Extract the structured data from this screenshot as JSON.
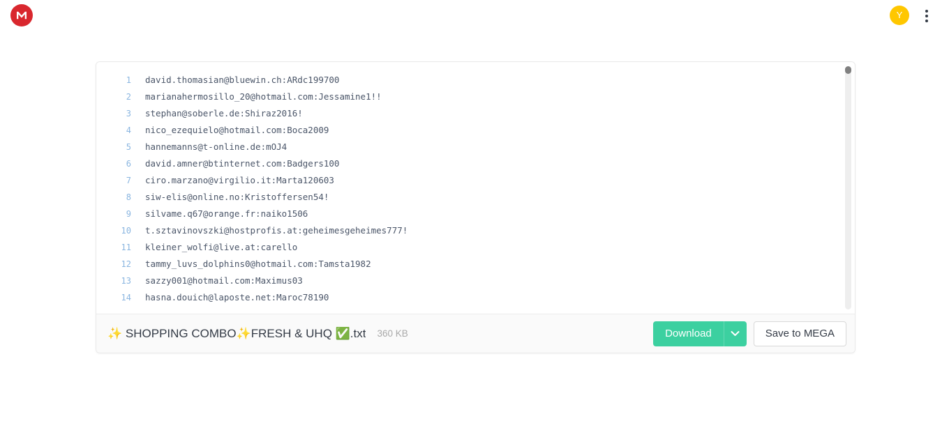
{
  "header": {
    "logo_letter": "M",
    "logo_color": "#d9272e",
    "avatar_initial": "Y",
    "avatar_color": "#ffc700",
    "menu_icon": "kebab-menu-icon"
  },
  "viewer": {
    "line_number_color": "#89b5e0",
    "text_color": "#4a5568",
    "lines": [
      {
        "n": "1",
        "text": "david.thomasian@bluewin.ch:ARdc199700"
      },
      {
        "n": "2",
        "text": "marianahermosillo_20@hotmail.com:Jessamine1!!"
      },
      {
        "n": "3",
        "text": "stephan@soberle.de:Shiraz2016!"
      },
      {
        "n": "4",
        "text": "nico_ezequielo@hotmail.com:Boca2009"
      },
      {
        "n": "5",
        "text": "hannemanns@t-online.de:mOJ4"
      },
      {
        "n": "6",
        "text": "david.amner@btinternet.com:Badgers100"
      },
      {
        "n": "7",
        "text": "ciro.marzano@virgilio.it:Marta120603"
      },
      {
        "n": "8",
        "text": "siw-elis@online.no:Kristoffersen54!"
      },
      {
        "n": "9",
        "text": "silvame.q67@orange.fr:naiko1506"
      },
      {
        "n": "10",
        "text": "t.sztavinovszki@hostprofis.at:geheimesgeheimes777!"
      },
      {
        "n": "11",
        "text": "kleiner_wolfi@live.at:carello"
      },
      {
        "n": "12",
        "text": "tammy_luvs_dolphins0@hotmail.com:Tamsta1982"
      },
      {
        "n": "13",
        "text": "sazzy001@hotmail.com:Maximus03"
      },
      {
        "n": "14",
        "text": "hasna.douich@laposte.net:Maroc78190"
      }
    ]
  },
  "footer": {
    "file_name": "✨ SHOPPING COMBO✨FRESH & UHQ ✅.txt",
    "file_size": "360 KB",
    "download_label": "Download",
    "save_label": "Save to MEGA",
    "download_color": "#3cd0a0"
  }
}
